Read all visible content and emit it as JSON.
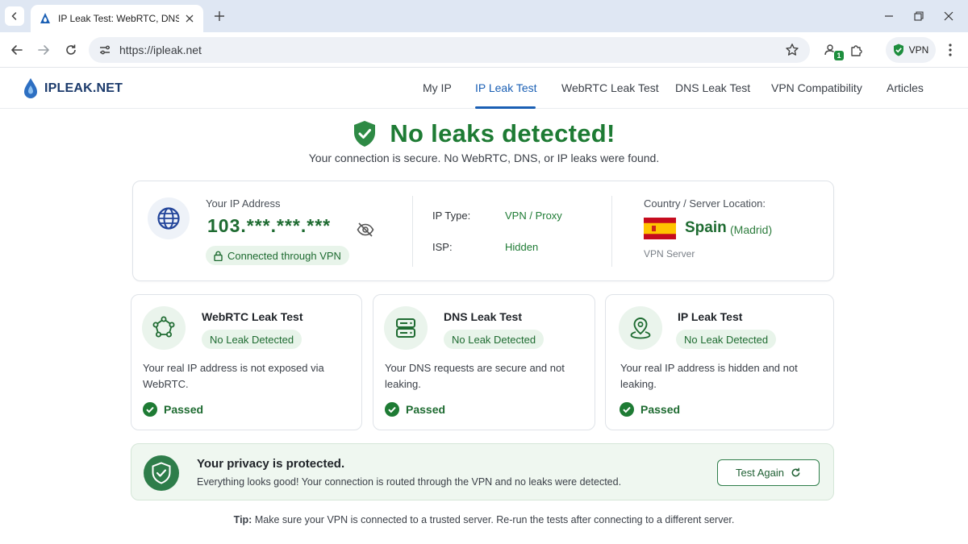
{
  "browser": {
    "tab_title": "IP Leak Test: WebRTC, DNS & IP",
    "url": "https://ipleak.net",
    "extension_badge": "1",
    "vpn_label": "VPN"
  },
  "site": {
    "logo": "IPLEAK.NET",
    "nav": [
      {
        "label": "My IP"
      },
      {
        "label": "IP Leak Test"
      },
      {
        "label": "WebRTC Leak Test"
      },
      {
        "label": "DNS Leak Test"
      },
      {
        "label": "VPN Compatibility"
      },
      {
        "label": "Articles"
      }
    ],
    "active_nav": "IP Leak Test"
  },
  "hero": {
    "title": "No leaks detected!",
    "subtitle": "Your connection is secure. No WebRTC, DNS, or IP leaks were found."
  },
  "ip_info": {
    "ip_label": "Your IP Address",
    "ip_value": "103.***.***.***",
    "vpn_badge": "Connected through VPN",
    "ip_type_label": "IP Type:",
    "ip_type_value": "VPN / Proxy",
    "isp_label": "ISP:",
    "isp_value": "Hidden",
    "country_label": "Country / Server Location:",
    "country": "Spain",
    "city": "(Madrid)",
    "server_label": "VPN Server"
  },
  "tests": [
    {
      "title": "WebRTC Leak Test",
      "badge": "No Leak Detected",
      "description": "Your real IP address is not exposed via WebRTC.",
      "result": "Passed",
      "icon": "webrtc-icon"
    },
    {
      "title": "DNS Leak Test",
      "badge": "No Leak Detected",
      "description": "Your DNS requests are secure and not leaking.",
      "result": "Passed",
      "icon": "server-icon"
    },
    {
      "title": "IP Leak Test",
      "badge": "No Leak Detected",
      "description": "Your real IP address is hidden and not leaking.",
      "result": "Passed",
      "icon": "map-pin-icon"
    }
  ],
  "privacy": {
    "title": "Your privacy is protected.",
    "text": "Everything looks good! Your connection is routed through the VPN and no leaks were detected.",
    "button": "Test Again"
  },
  "tip": {
    "prefix": "Tip:",
    "text": "Make sure your VPN is connected to a trusted server. Re-run the tests after connecting to a different server."
  },
  "colors": {
    "accent_green": "#1e7b34",
    "nav_active": "#1a5fb4",
    "spain_red": "#c60b1e",
    "spain_yellow": "#ffc400"
  }
}
